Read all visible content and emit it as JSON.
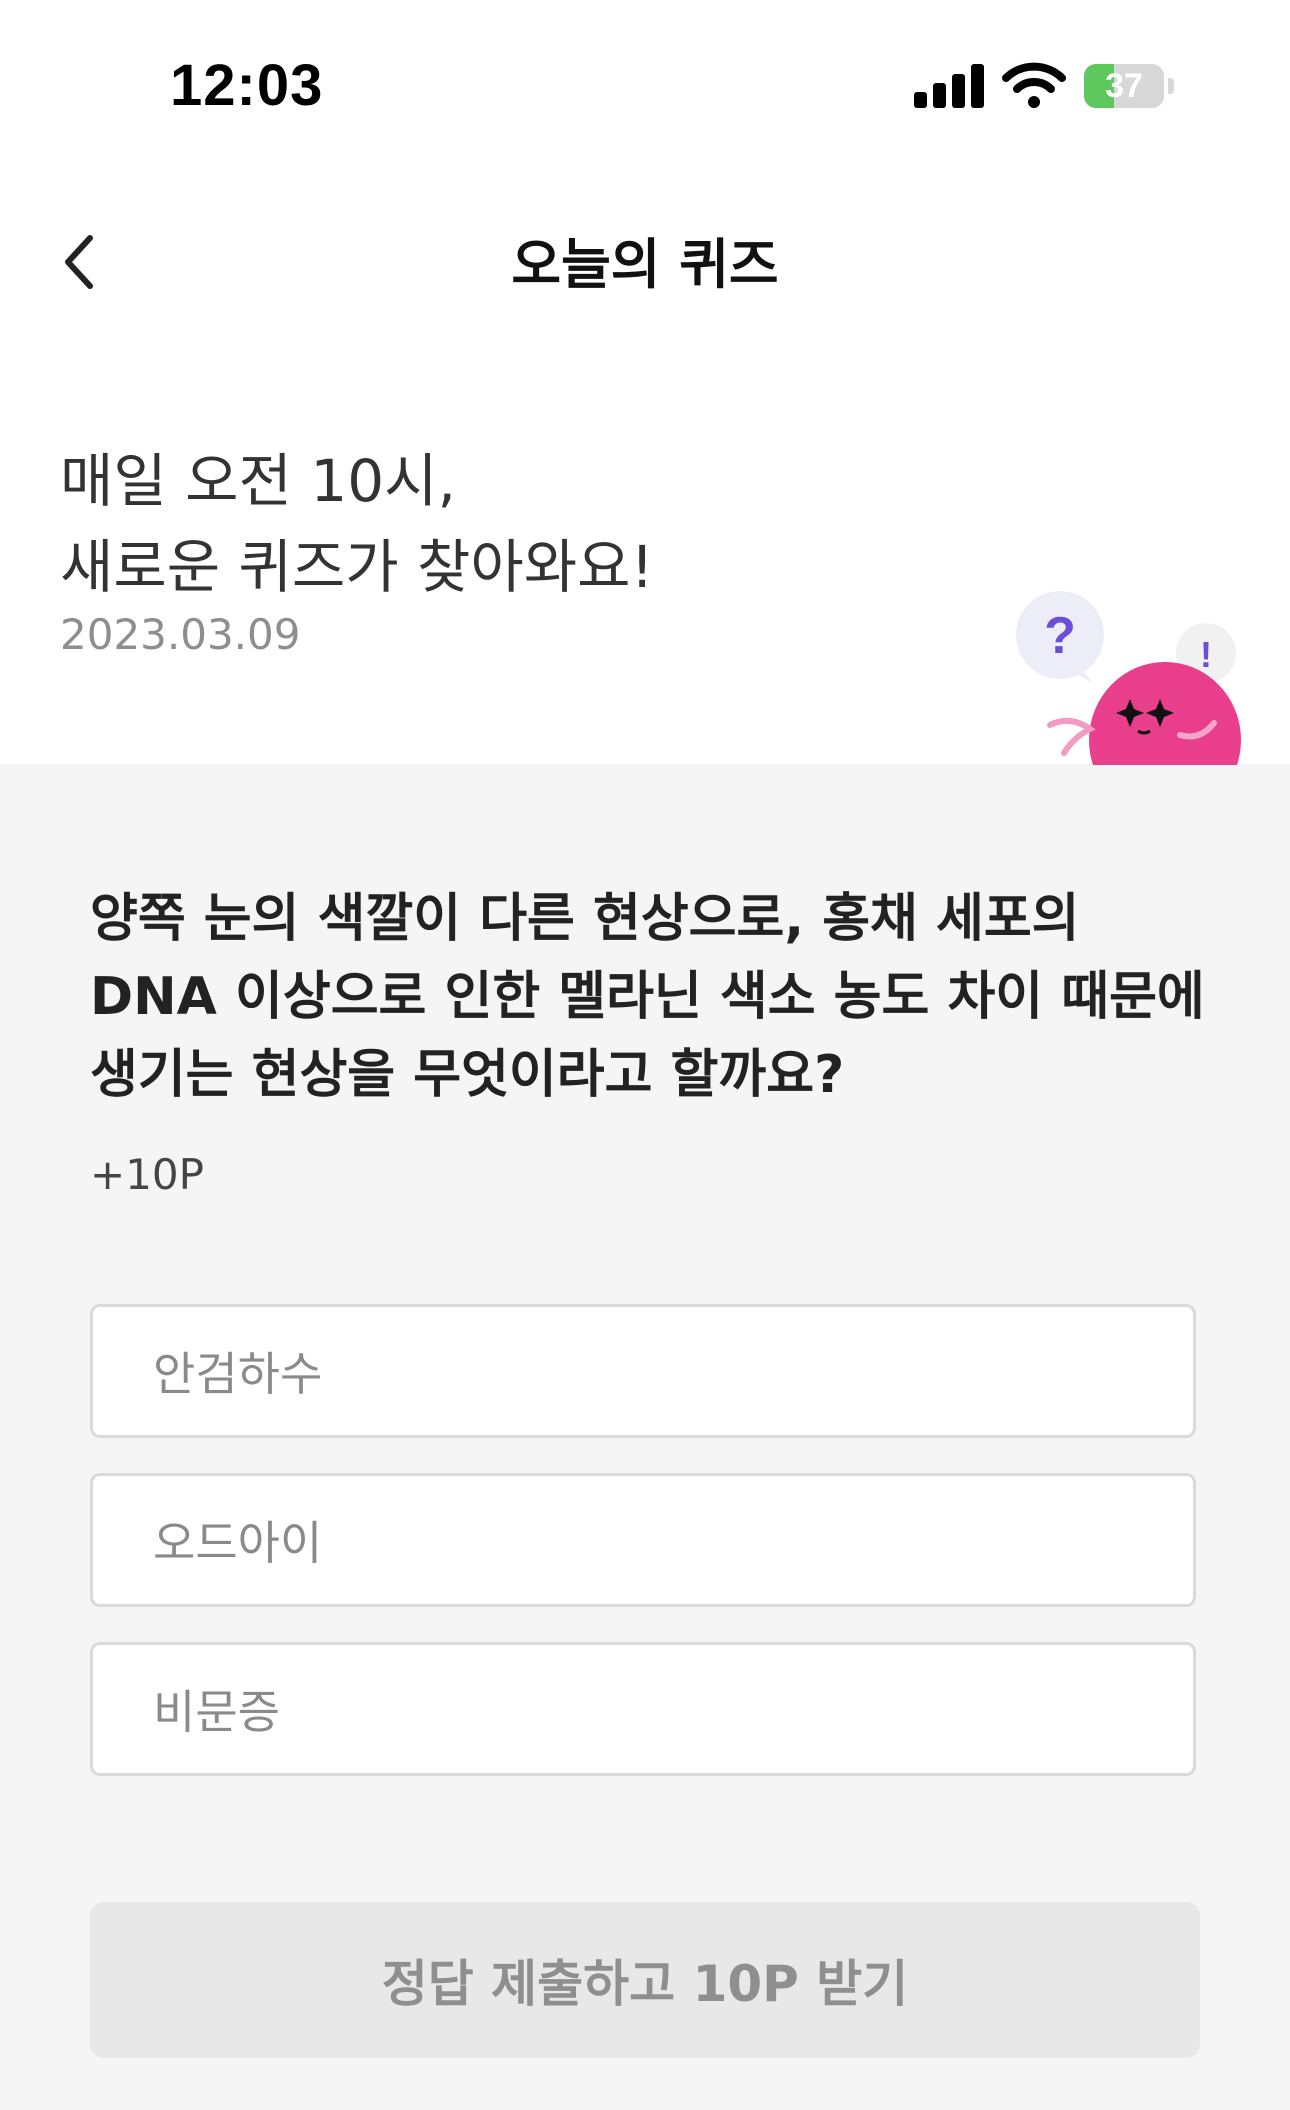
{
  "status_bar": {
    "time": "12:03",
    "battery_level": "37",
    "battery_fraction": 0.37,
    "battery_color": "#5cc85e",
    "icons": [
      "signal-icon",
      "wifi-icon",
      "battery-charging-icon"
    ]
  },
  "header": {
    "title": "오늘의 퀴즈",
    "back_icon": "chevron-left-icon"
  },
  "intro": {
    "line1": "매일 오전 10시,",
    "line2": "새로운 퀴즈가 찾아와요!",
    "date": "2023.03.09",
    "mascot": {
      "question_mark": "?",
      "exclamation": "!",
      "color": "#e83e8c"
    }
  },
  "quiz": {
    "question": "양쪽 눈의 색깔이 다른 현상으로, 홍채 세포의 DNA 이상으로 인한 멜라닌 색소 농도 차이 때문에 생기는 현상을 무엇이라고 할까요?",
    "points": "+10P",
    "options": [
      {
        "label": "안검하수"
      },
      {
        "label": "오드아이"
      },
      {
        "label": "비문증"
      }
    ],
    "submit_label": "정답 제출하고 10P 받기"
  }
}
